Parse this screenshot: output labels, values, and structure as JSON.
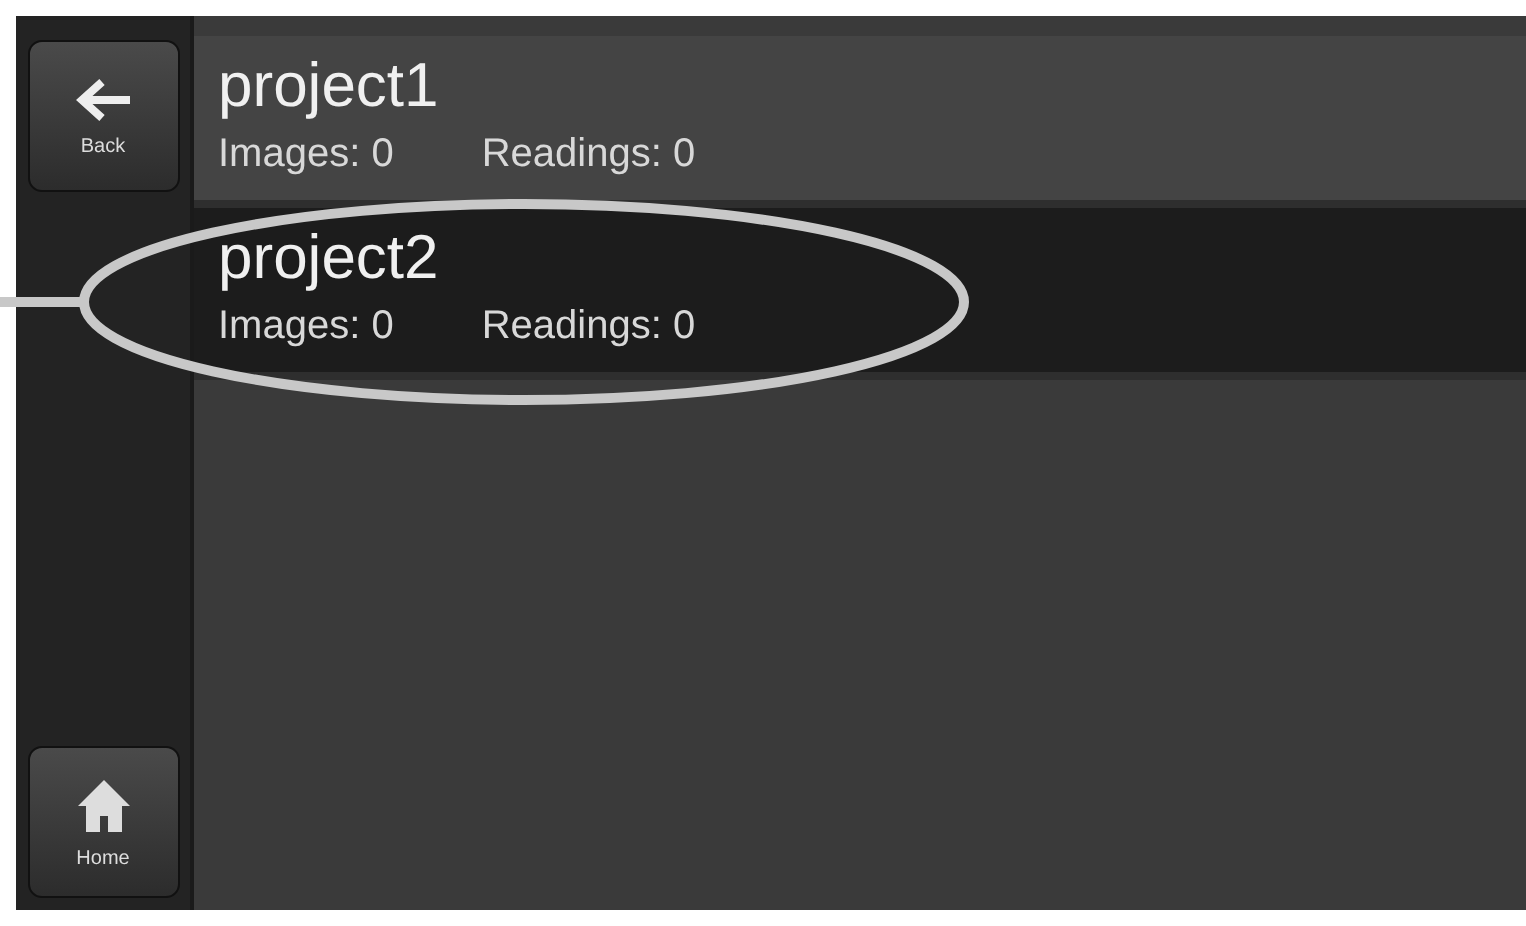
{
  "sidebar": {
    "back": {
      "label": "Back"
    },
    "home": {
      "label": "Home"
    }
  },
  "projects": [
    {
      "name": "project1",
      "images": "Images: 0",
      "readings": "Readings: 0",
      "selected": false
    },
    {
      "name": "project2",
      "images": "Images: 0",
      "readings": "Readings: 0",
      "selected": true
    }
  ]
}
